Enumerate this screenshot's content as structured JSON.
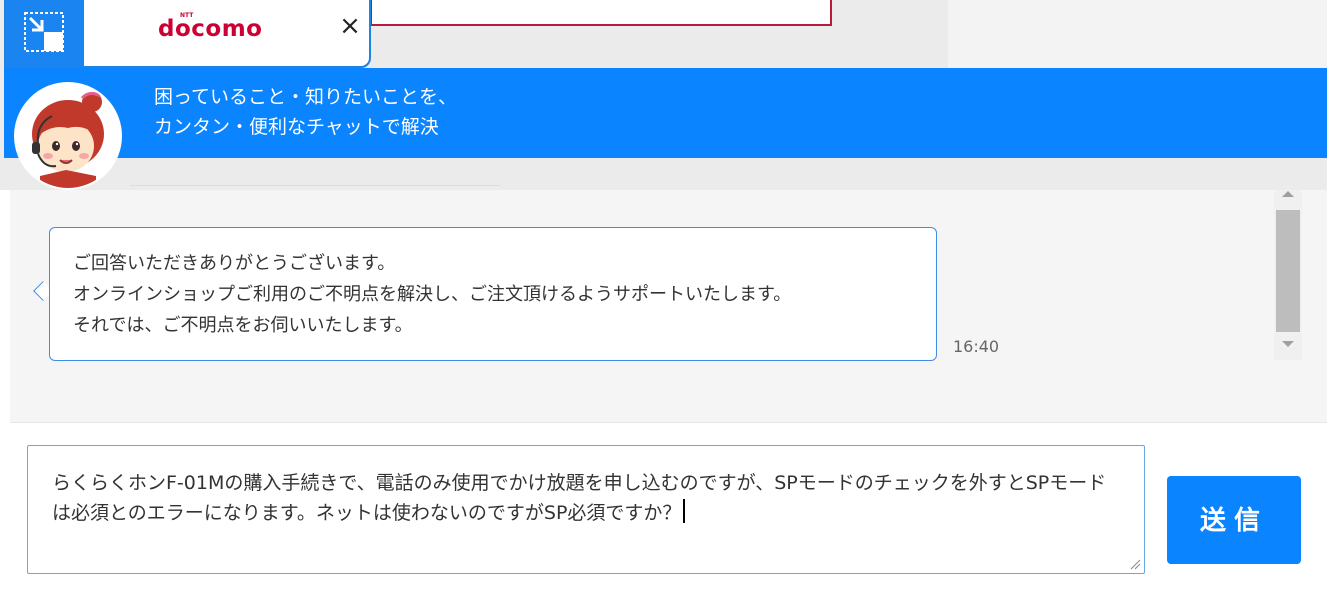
{
  "widget": {
    "logo": "docomo",
    "logo_superscript": "NTT",
    "close_label": "×"
  },
  "header": {
    "line1": "困っていること・知りたいことを、",
    "line2": "カンタン・便利なチャットで解決"
  },
  "chat": {
    "messages": [
      {
        "sender": "bot",
        "text": "ご回答いただきありがとうございます。\nオンラインショップご利用のご不明点を解決し、ご注文頂けるようサポートいたします。\nそれでは、ご不明点をお伺いいたします。",
        "time": "16:40"
      }
    ]
  },
  "input": {
    "value": "らくらくホンF-01Mの購入手続きで、電話のみ使用でかけ放題を申し込むのですが、SPモードのチェックを外すとSPモードは必須とのエラーになります。ネットは使わないのですがSP必須ですか？"
  },
  "send_button": {
    "label": "送信"
  },
  "colors": {
    "brand_blue": "#0a84ff",
    "docomo_red": "#cc0033",
    "bubble_border": "#3f8ee0"
  },
  "icons": {
    "minimize": "minimize-icon",
    "close": "close-icon",
    "avatar": "operator-avatar"
  }
}
